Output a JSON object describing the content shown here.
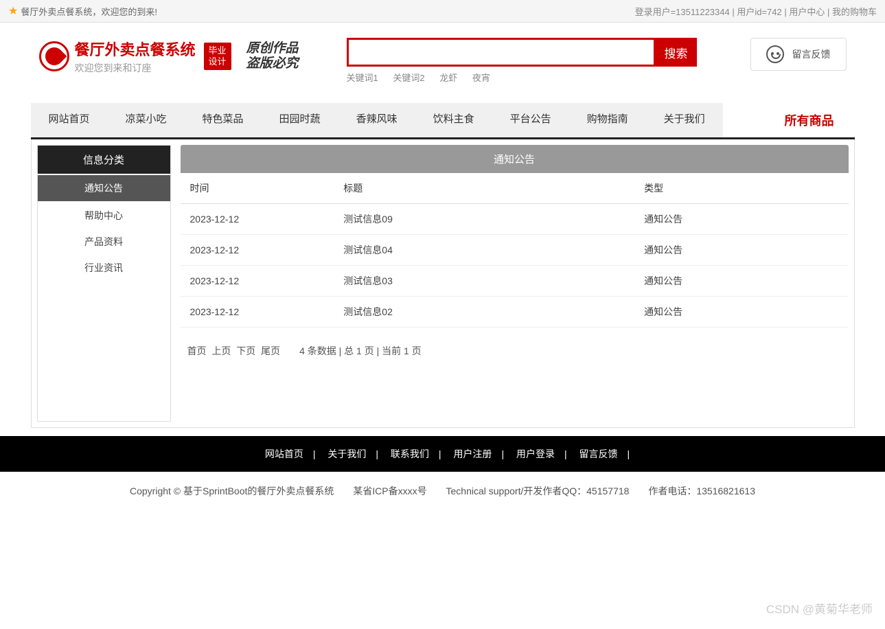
{
  "topbar": {
    "welcome": "餐厅外卖点餐系统，欢迎您的到来!",
    "login_user_label": "登录用户=13511223344",
    "user_id_label": "用户id=742",
    "user_center": "用户中心",
    "my_cart": "我的购物车"
  },
  "logo": {
    "title": "餐厅外卖点餐系统",
    "subtitle": "欢迎您到来和订座",
    "badge_line1": "毕业",
    "badge_line2": "设计",
    "script1": "原创作品",
    "script2": "盗版必究"
  },
  "search": {
    "button": "搜索",
    "placeholder": "",
    "keywords": [
      "关键词1",
      "关键词2",
      "龙虾",
      "夜宵"
    ]
  },
  "feedback": {
    "label": "留言反馈"
  },
  "nav": {
    "items": [
      "网站首页",
      "凉菜小吃",
      "特色菜品",
      "田园时蔬",
      "香辣风味",
      "饮料主食",
      "平台公告",
      "购物指南",
      "关于我们"
    ],
    "all_products": "所有商品"
  },
  "sidebar": {
    "title": "信息分类",
    "items": [
      {
        "label": "通知公告",
        "active": true
      },
      {
        "label": "帮助中心",
        "active": false
      },
      {
        "label": "产品资料",
        "active": false
      },
      {
        "label": "行业资讯",
        "active": false
      }
    ]
  },
  "content": {
    "header": "通知公告",
    "columns": {
      "time": "时间",
      "title": "标题",
      "type": "类型"
    },
    "rows": [
      {
        "time": "2023-12-12",
        "title": "测试信息09",
        "type": "通知公告"
      },
      {
        "time": "2023-12-12",
        "title": "测试信息04",
        "type": "通知公告"
      },
      {
        "time": "2023-12-12",
        "title": "测试信息03",
        "type": "通知公告"
      },
      {
        "time": "2023-12-12",
        "title": "测试信息02",
        "type": "通知公告"
      }
    ]
  },
  "pager": {
    "first": "首页",
    "prev": "上页",
    "next": "下页",
    "last": "尾页",
    "info": "4 条数据 | 总 1 页 | 当前 1 页"
  },
  "footer_nav": [
    "网站首页",
    "关于我们",
    "联系我们",
    "用户注册",
    "用户登录",
    "留言反馈"
  ],
  "footer_copy": {
    "copyright": "Copyright © 基于SprintBoot的餐厅外卖点餐系统",
    "icp": "某省ICP备xxxx号",
    "tech": "Technical support/开发作者QQ：45157718",
    "phone": "作者电话：13516821613"
  },
  "watermark": "CSDN @黄菊华老师"
}
